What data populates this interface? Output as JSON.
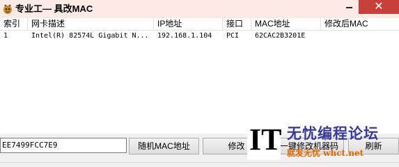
{
  "window": {
    "title": "专业工— 具改MAC",
    "close_glyph": "✕"
  },
  "list": {
    "columns": [
      "索引",
      "网卡描述",
      "IP地址",
      "接口",
      "MAC地址",
      "修改后MAC"
    ],
    "rows": [
      [
        "1",
        "Intel(R) 82574L Gigabit N...",
        "192.168.1.104",
        "PCI",
        "62CAC2B3201E",
        ""
      ]
    ]
  },
  "controls": {
    "mac_input_value": "EE7499FCC7E9",
    "random_mac_label": "随机MAC地址",
    "modify_label": "修改",
    "oneclick_label": "一键修改机器码",
    "refresh_label": "刷新"
  },
  "watermark": {
    "logo": "IT",
    "line1": "无忧编程论坛",
    "line2": "就发无忧  whct.net"
  },
  "colors": {
    "titlebar_bg": "#fbeae6",
    "close_button": "#c7403a",
    "watermark_blue": "#3a3a9a",
    "watermark_orange": "#e06a00"
  }
}
